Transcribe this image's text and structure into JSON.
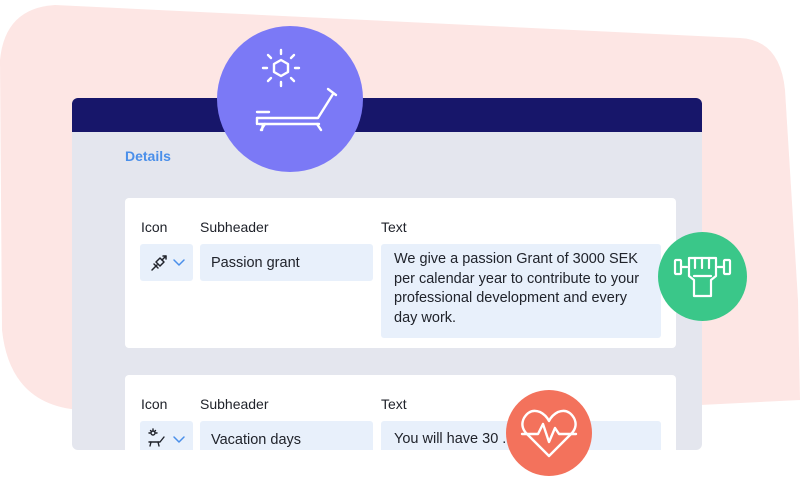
{
  "colors": {
    "blob": "#fde6e4",
    "titlebar": "#17166a",
    "window_bg": "#e4e6ee",
    "details_title": "#4a8fea",
    "field_bg": "#e8f0fb",
    "badge_purple": "#7b79f6",
    "badge_green": "#3ac789",
    "badge_coral": "#f3725c"
  },
  "section": {
    "title": "Details"
  },
  "cards": [
    {
      "labels": {
        "icon": "Icon",
        "subheader": "Subheader",
        "text": "Text"
      },
      "icon": "gift-link-icon",
      "subheader": "Passion grant",
      "text": "We give a passion Grant of 3000 SEK per calendar year to contribute to your professional development and every day work."
    },
    {
      "labels": {
        "icon": "Icon",
        "subheader": "Subheader",
        "text": "Text"
      },
      "icon": "sun-lounger-icon",
      "subheader": "Vacation days",
      "text": "You will have 30 ... n each"
    }
  ],
  "badges": [
    {
      "name": "sun-lounger-icon",
      "color": "#7b79f6"
    },
    {
      "name": "fist-weights-icon",
      "color": "#3ac789"
    },
    {
      "name": "heart-pulse-icon",
      "color": "#f3725c"
    }
  ]
}
